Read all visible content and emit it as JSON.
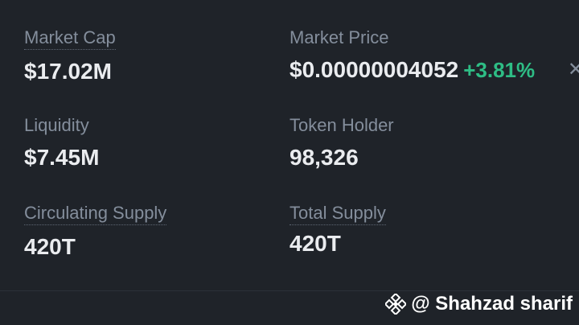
{
  "stats": {
    "market_cap": {
      "label": "Market Cap",
      "value": "$17.02M"
    },
    "market_price": {
      "label": "Market Price",
      "value": "$0.00000004052",
      "change": "+3.81%"
    },
    "liquidity": {
      "label": "Liquidity",
      "value": "$7.45M"
    },
    "token_holder": {
      "label": "Token Holder",
      "value": "98,326"
    },
    "circulating_supply": {
      "label": "Circulating Supply",
      "value": "420T"
    },
    "total_supply": {
      "label": "Total Supply",
      "value": "420T"
    }
  },
  "watermark": {
    "text": "@ Shahzad sharif"
  },
  "colors": {
    "background": "#1f2329",
    "label": "#848e9c",
    "value": "#eaecef",
    "positive_change": "#2ebd85"
  },
  "icons": [
    "binance-logo-icon",
    "close-icon"
  ]
}
